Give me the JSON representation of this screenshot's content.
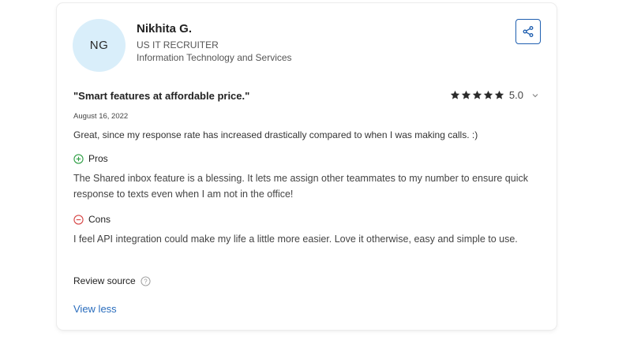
{
  "reviewer": {
    "initials": "NG",
    "name": "Nikhita G.",
    "job_title": "US IT RECRUITER",
    "industry": "Information Technology and Services"
  },
  "review": {
    "title": "\"Smart features at affordable price.\"",
    "rating": 5,
    "rating_label": "5.0",
    "date": "August 16, 2022",
    "summary": "Great, since my response rate has increased drastically compared to when I was making calls. :)",
    "pros_label": "Pros",
    "pros_text": "The Shared inbox feature is a blessing. It lets me assign other teammates to my number to ensure quick response to texts even when I am not in the office!",
    "cons_label": "Cons",
    "cons_text": "I feel API integration could make my life a little more easier. Love it otherwise, easy and simple to use.",
    "source_label": "Review source",
    "view_less_label": "View less"
  },
  "icons": {
    "share": "share-icon",
    "star": "star-icon",
    "chevron": "chevron-down-icon",
    "pros": "plus-circle-icon",
    "cons": "minus-circle-icon",
    "help": "question-circle-icon"
  },
  "colors": {
    "avatar_bg": "#d9eefa",
    "accent_blue": "#1f5fb0",
    "link_blue": "#2a6dbd",
    "pros_green": "#2e9e44",
    "cons_red": "#d64545",
    "star": "#2b2b2b"
  }
}
